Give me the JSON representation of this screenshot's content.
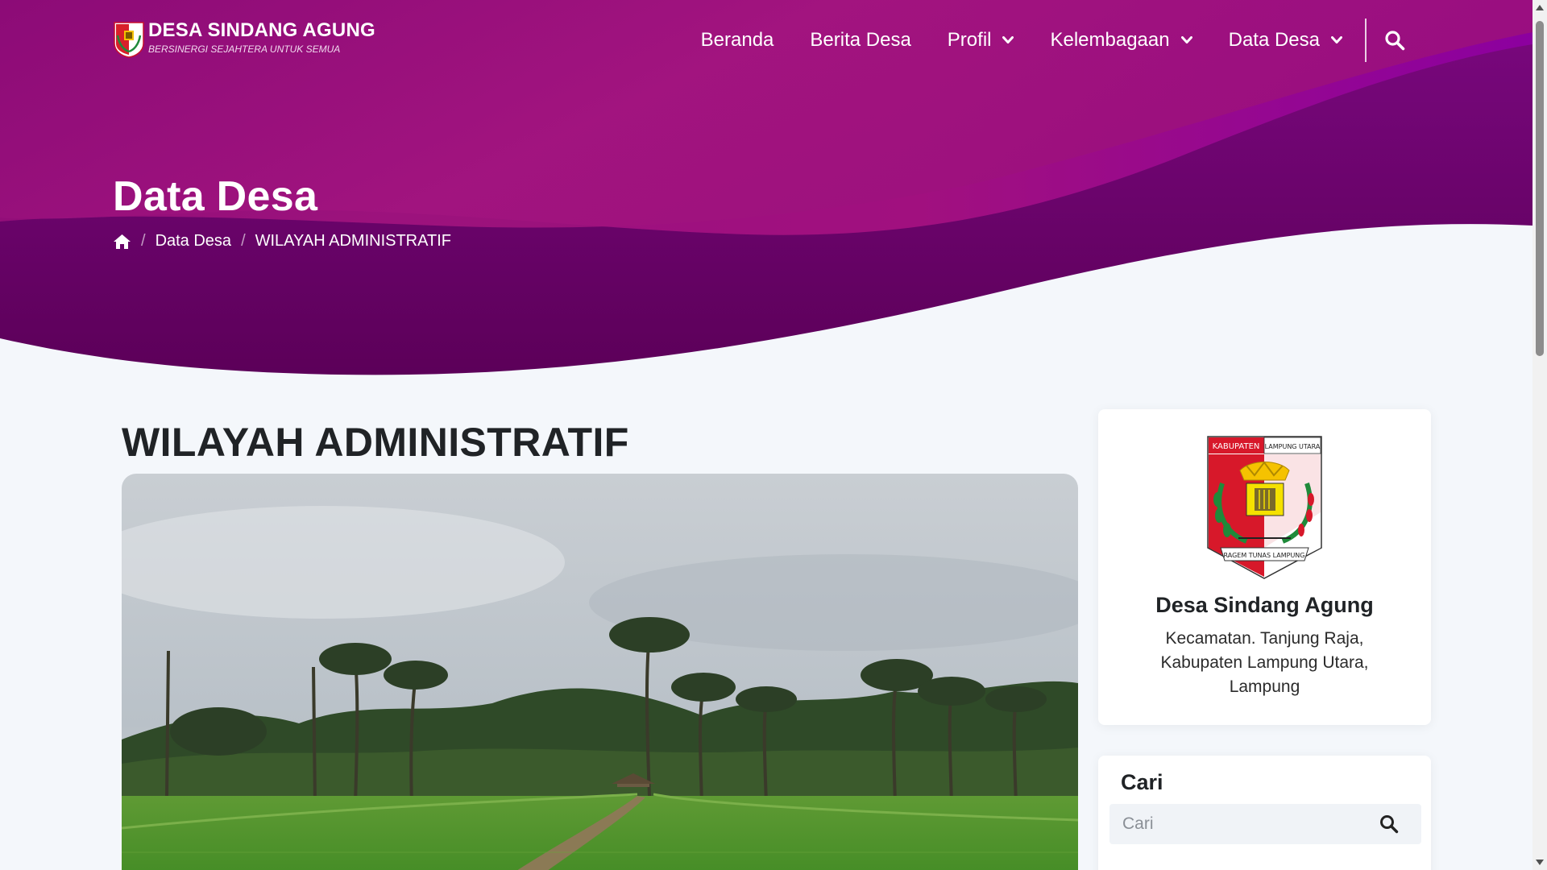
{
  "brand": {
    "name": "DESA SINDANG AGUNG",
    "tagline": "BERSINERGI SEJAHTERA UNTUK SEMUA",
    "logo_icon": "village-emblem-icon"
  },
  "nav": {
    "items": [
      {
        "label": "Beranda",
        "dropdown": false
      },
      {
        "label": "Berita Desa",
        "dropdown": false
      },
      {
        "label": "Profil",
        "dropdown": true
      },
      {
        "label": "Kelembagaan",
        "dropdown": true
      },
      {
        "label": "Data Desa",
        "dropdown": true
      }
    ],
    "search_icon": "search-icon"
  },
  "hero": {
    "title": "Data Desa",
    "breadcrumb": [
      {
        "label": "Data Desa"
      },
      {
        "label": "WILAYAH ADMINISTRATIF"
      }
    ],
    "home_icon": "home-icon"
  },
  "post": {
    "title": "WILAYAH ADMINISTRATIF",
    "image": "rice-field-photo"
  },
  "sidebar": {
    "profile": {
      "logo_icon": "kabupaten-lampung-utara-emblem",
      "logo_text_left": "KABUPATEN",
      "logo_text_right": "LAMPUNG UTARA",
      "logo_motto": "RAGEM TUNAS LAMPUNG",
      "name": "Desa Sindang Agung",
      "address": "Kecamatan. Tanjung Raja, Kabupaten Lampung Utara, Lampung"
    },
    "search": {
      "title": "Cari",
      "placeholder": "Cari",
      "value": ""
    }
  },
  "colors": {
    "hero_magenta": "#8a0a74",
    "hero_purple": "#7a0085",
    "hero_dark": "#5e0060",
    "page_bg": "#f4f7fb"
  }
}
